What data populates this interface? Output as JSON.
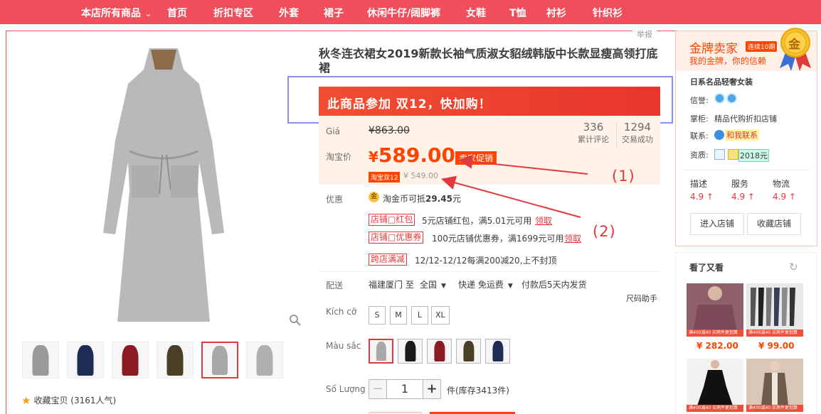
{
  "topnav": {
    "items": [
      "本店所有商品",
      "首页",
      "折扣专区",
      "外套",
      "裙子",
      "休闲牛仔/阔脚裤",
      "女鞋",
      "T恤",
      "衬衫",
      "针织衫"
    ],
    "dropdown_caret": "⌄"
  },
  "report_label": "举报",
  "gallery": {
    "favorite_label": "收藏宝贝 (3161人气)",
    "thumb_colors": [
      "#9a9a9c",
      "#1f2a55",
      "#8b1a24",
      "#4a3f26",
      "#a8a8aa",
      "#b0b0b2"
    ],
    "active_thumb_index": 4
  },
  "product": {
    "title": "秋冬连衣裙女2019新款长袖气质淑女貂绒韩版中长款显瘦高领打底裙",
    "promo_banner": "此商品参加 双12，快加购！",
    "price_label": "Giá",
    "original_price": "¥863.00",
    "stats": [
      {
        "value": "336",
        "label": "累计评论"
      },
      {
        "value": "1294",
        "label": "交易成功"
      }
    ],
    "taobao_price_label": "淘宝价",
    "currency_symbol": "¥",
    "current_price": "589.00",
    "sale_tag": "卖家促销",
    "d12_tag": "淘宝双12",
    "d12_price": "¥ 549.00",
    "benefits_label": "优惠",
    "coin_icon": "金",
    "coin_text_prefix": "淘金币可抵",
    "coin_amount": "29.45",
    "coin_text_suffix": "元",
    "coupons": [
      {
        "tag": "店铺□红包",
        "text": "5元店铺红包，满5.01元可用",
        "action": "领取"
      },
      {
        "tag": "店铺□优惠券",
        "text": "100元店铺优惠券，满1699元可用",
        "action": "领取"
      },
      {
        "tag": "跨店满减",
        "text": "12/12-12/12每满200减20,上不封顶",
        "action": ""
      }
    ],
    "shipping_label": "配送",
    "ship_from": "福建厦门",
    "ship_to_word": "至",
    "ship_to": "全国",
    "ship_method": "快递 免运费",
    "ship_time": "付款后5天内发货",
    "size_help": "尺码助手",
    "size_label": "Kích cỡ",
    "sizes": [
      "S",
      "M",
      "L",
      "XL"
    ],
    "color_label": "Màu sắc",
    "color_swatches": [
      "#a8a8aa",
      "#1a1a1a",
      "#8b1a24",
      "#4a3f26",
      "#1f2a55"
    ],
    "selected_color_index": 0,
    "qty_label": "Số Lượng",
    "qty_minus": "−",
    "qty_plus": "+",
    "qty_value": "1",
    "stock_text": "件(库存3413件)"
  },
  "annotations": [
    "(1)",
    "(2)"
  ],
  "seller": {
    "gold_title": "金牌卖家",
    "gold_badge": "连续10期",
    "gold_sub": "我的金牌，你的信赖",
    "medal_char": "金",
    "shop_name": "日系名品轻奢女装",
    "credit_label": "信誉:",
    "keeper_label": "掌柜:",
    "keeper_name": "精品代购折扣店铺",
    "contact_label": "联系:",
    "contact_link": "和我联系",
    "qualification_label": "资质:",
    "cert_year": "2018元",
    "scores": [
      {
        "label": "描述",
        "value": "4.9 ↑"
      },
      {
        "label": "服务",
        "value": "4.9 ↑"
      },
      {
        "label": "物流",
        "value": "4.9 ↑"
      }
    ],
    "enter_shop": "进入店铺",
    "fav_shop": "收藏店铺"
  },
  "also_viewed": {
    "title": "看了又看",
    "refresh_icon": "↻",
    "items": [
      {
        "price": "¥ 282.00",
        "strip": "满400减40 买两件更划算"
      },
      {
        "price": "¥ 99.00",
        "strip": "满400减40 买两件更划算"
      },
      {
        "price": "",
        "strip": "满400减40 买两件更划算"
      },
      {
        "price": "",
        "strip": "满400减40 买两件更划算"
      }
    ]
  }
}
